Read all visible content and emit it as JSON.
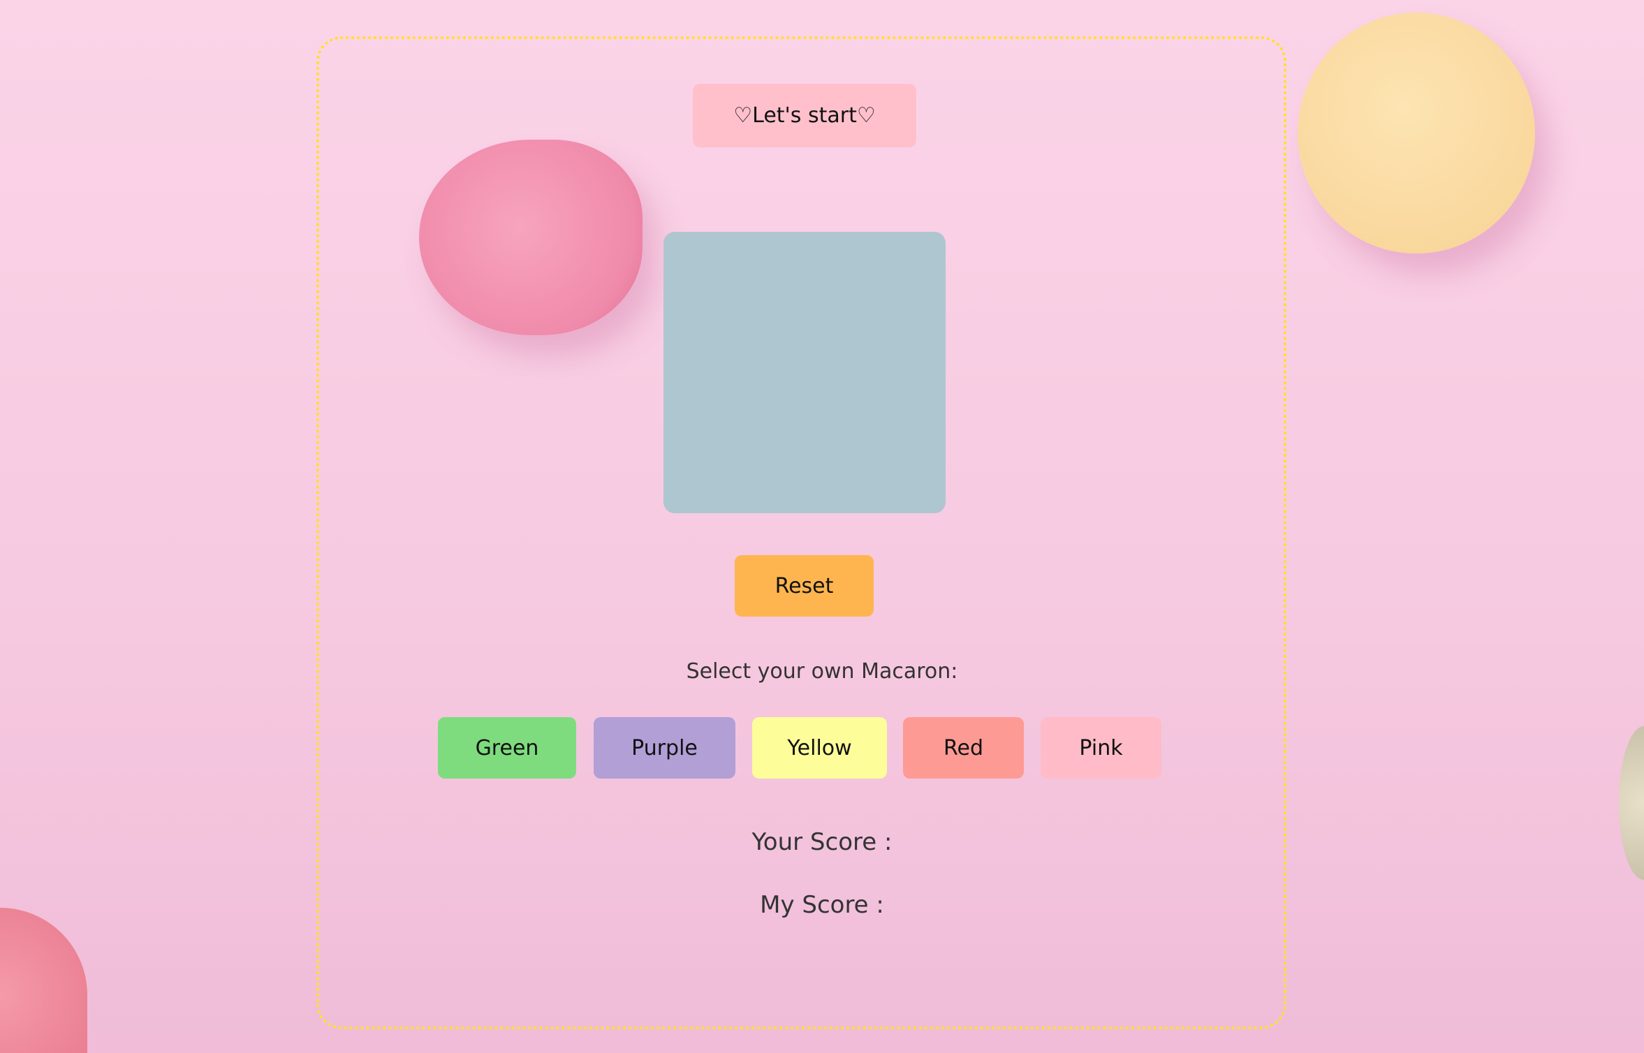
{
  "start_button": {
    "label": "♡Let's start♡"
  },
  "color_square": {
    "color": "#aec6cf"
  },
  "reset_button": {
    "label": "Reset",
    "color": "#ffb54f"
  },
  "select_prompt": "Select your own Macaron:",
  "colors": [
    {
      "label": "Green",
      "color": "#7edc7e"
    },
    {
      "label": "Purple",
      "color": "#b19fd6"
    },
    {
      "label": "Yellow",
      "color": "#fdfd9a"
    },
    {
      "label": "Red",
      "color": "#fe9a94"
    },
    {
      "label": "Pink",
      "color": "#ffbbc8"
    }
  ],
  "scores": {
    "your_label": "Your Score :",
    "my_label": "My Score :"
  }
}
